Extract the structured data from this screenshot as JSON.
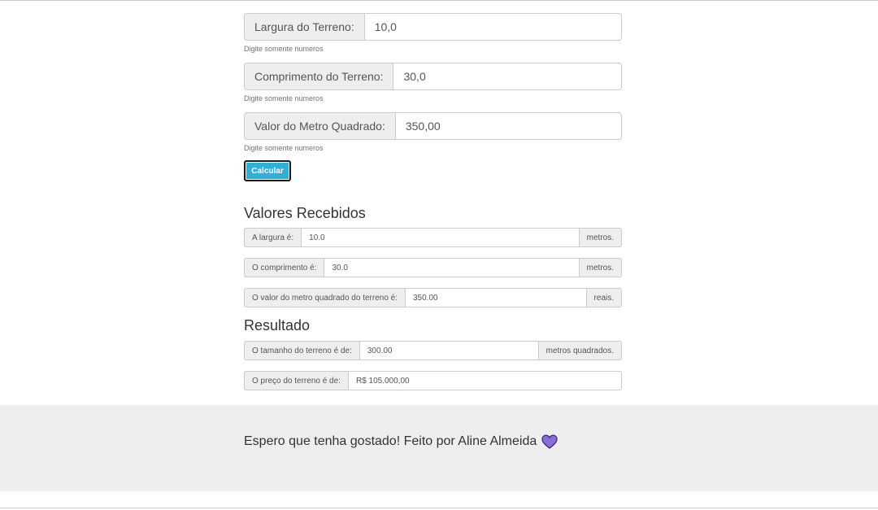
{
  "form": {
    "largura": {
      "label": "Largura do Terreno:",
      "value": "10,0",
      "help": "Digite somente numeros"
    },
    "comprimento": {
      "label": "Comprimento do Terreno:",
      "value": "30,0",
      "help": "Digite somente numeros"
    },
    "valor": {
      "label": "Valor do Metro Quadrado:",
      "value": "350,00",
      "help": "Digite somente numeros"
    },
    "calcular_label": "Calcular"
  },
  "recebidos": {
    "title": "Valores Recebidos",
    "largura": {
      "label": "A largura é:",
      "value": "10.0",
      "unit": "metros."
    },
    "comprimento": {
      "label": "O comprimento é:",
      "value": "30.0",
      "unit": "metros."
    },
    "valor": {
      "label": "O valor do metro quadrado do terreno é:",
      "value": "350.00",
      "unit": "reais."
    }
  },
  "resultado": {
    "title": "Resultado",
    "tamanho": {
      "label": "O tamanho do terreno é de:",
      "value": "300.00",
      "unit": "metros quadrados."
    },
    "preco": {
      "label": "O preço do terreno é de:",
      "value": "R$ 105.000,00"
    }
  },
  "footer": {
    "text": "Espero que tenha gostado! Feito por Aline Almeida",
    "icon": "purple-heart-icon",
    "heart_color": "#8b6fd6"
  }
}
